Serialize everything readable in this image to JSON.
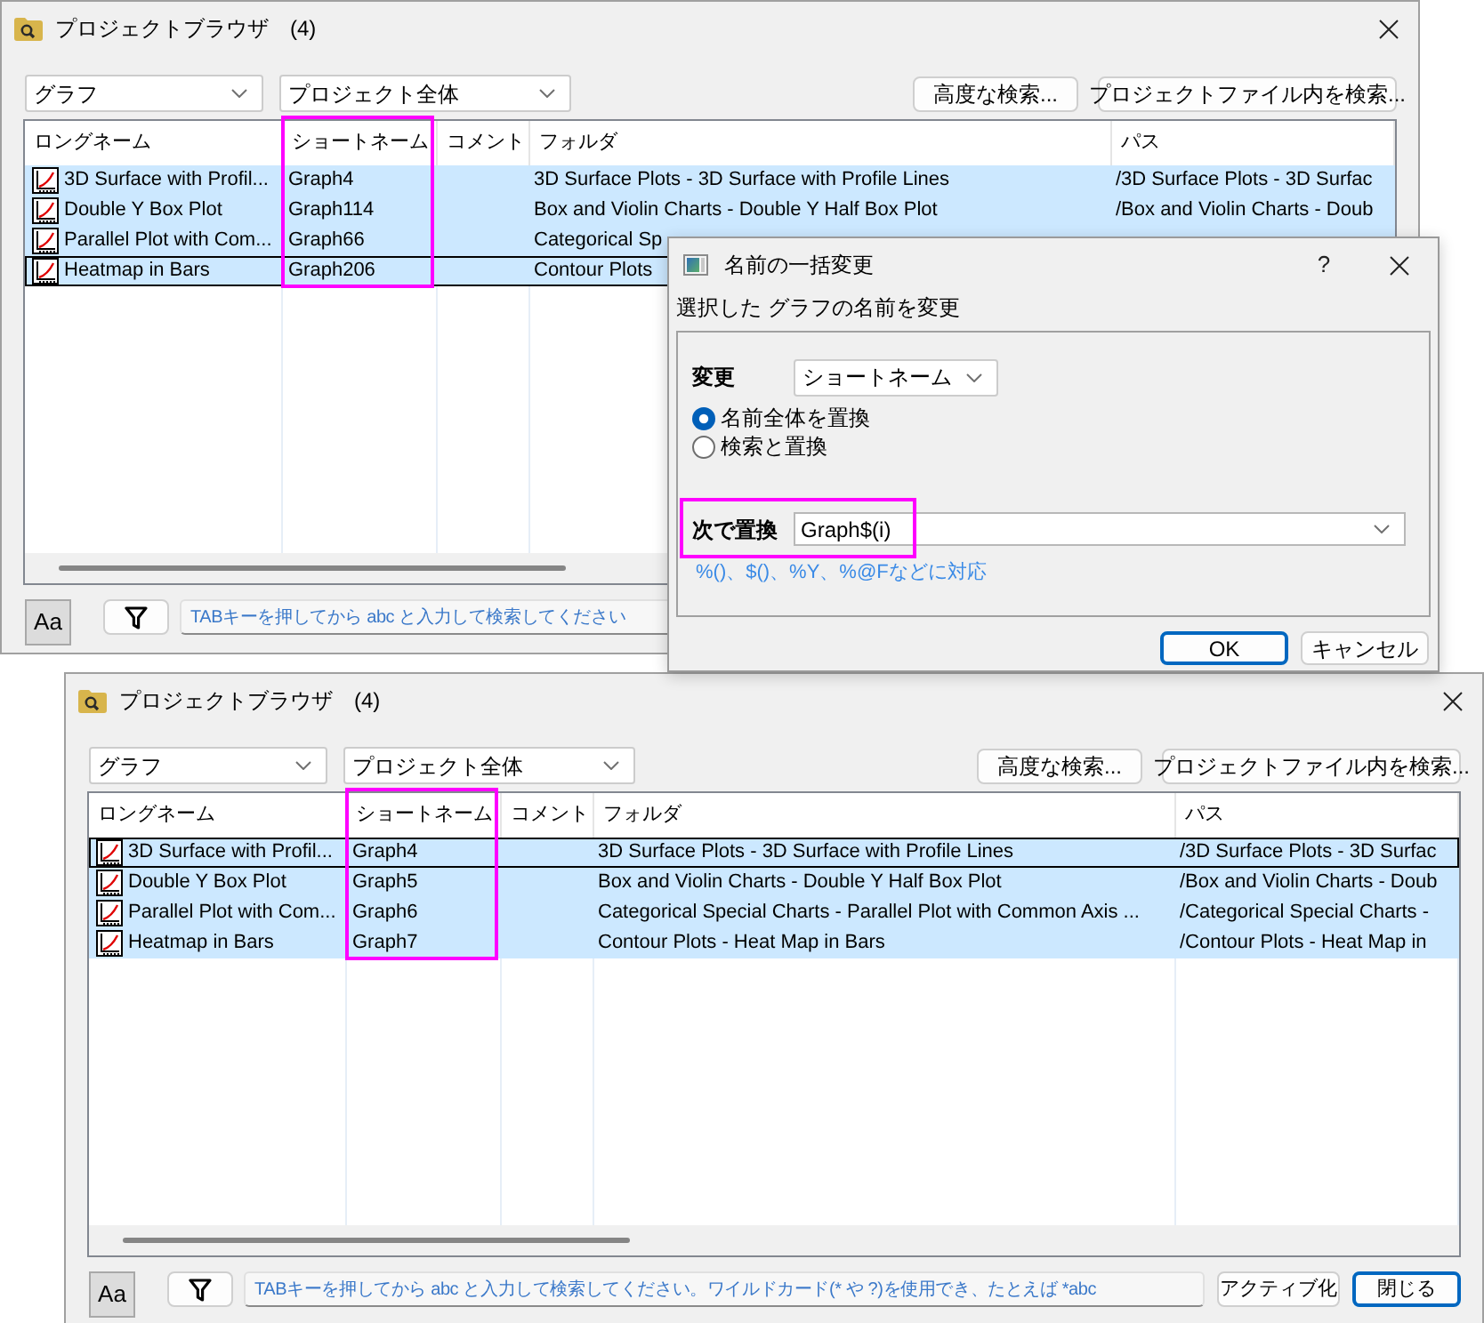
{
  "browser_windows": [
    {
      "title": "プロジェクトブラウザ",
      "count": "(4)",
      "type_filter": "グラフ",
      "scope_filter": "プロジェクト全体",
      "buttons": [
        "高度な検索...",
        "プロジェクトファイル内を検索..."
      ],
      "columns": [
        {
          "label": "ロングネーム"
        },
        {
          "label": "ショートネーム",
          "highlighted": true
        },
        {
          "label": "コメント"
        },
        {
          "label": "フォルダ"
        },
        {
          "label": "パス"
        }
      ],
      "rows": [
        {
          "long_name": "3D Surface with Profil...",
          "short_name": "Graph4",
          "folder": "3D Surface Plots - 3D Surface with Profile Lines",
          "path": "/3D Surface Plots - 3D Surfac",
          "selected": true,
          "focused": false
        },
        {
          "long_name": "Double Y Box Plot",
          "short_name": "Graph114",
          "folder": "Box and Violin Charts - Double Y Half Box Plot",
          "path": "/Box and Violin Charts - Doub",
          "selected": true,
          "focused": false
        },
        {
          "long_name": "Parallel Plot with Com...",
          "short_name": "Graph66",
          "folder": "Categorical Sp",
          "selected": true,
          "focused": false
        },
        {
          "long_name": "Heatmap in Bars",
          "short_name": "Graph206",
          "folder": "Contour Plots",
          "selected": true,
          "focused": true
        }
      ],
      "font_button": "Aa",
      "search": {
        "placeholder": "TABキーを押してから abc と入力して検索してください"
      }
    },
    {
      "title": "プロジェクトブラウザ",
      "count": "(4)",
      "type_filter": "グラフ",
      "scope_filter": "プロジェクト全体",
      "buttons": [
        "高度な検索...",
        "プロジェクトファイル内を検索..."
      ],
      "columns": [
        {
          "label": "ロングネーム"
        },
        {
          "label": "ショートネーム",
          "highlighted": true
        },
        {
          "label": "コメント"
        },
        {
          "label": "フォルダ"
        },
        {
          "label": "パス"
        }
      ],
      "rows": [
        {
          "long_name": "3D Surface with Profil...",
          "short_name": "Graph4",
          "folder": "3D Surface Plots - 3D Surface with Profile Lines",
          "path": "/3D Surface Plots - 3D Surfac",
          "selected": true,
          "focused": true
        },
        {
          "long_name": "Double Y Box Plot",
          "short_name": "Graph5",
          "folder": "Box and Violin Charts - Double Y Half Box Plot",
          "path": "/Box and Violin Charts - Doub",
          "selected": true,
          "focused": false
        },
        {
          "long_name": "Parallel Plot with Com...",
          "short_name": "Graph6",
          "folder": "Categorical Special Charts - Parallel Plot with Common Axis ...",
          "path": "/Categorical Special Charts -",
          "selected": true,
          "focused": false
        },
        {
          "long_name": "Heatmap in Bars",
          "short_name": "Graph7",
          "folder": "Contour Plots - Heat Map in Bars",
          "path": "/Contour Plots - Heat Map in",
          "selected": true,
          "focused": false
        }
      ],
      "font_button": "Aa",
      "search": {
        "placeholder": "TABキーを押してから abc と入力して検索してください。ワイルドカード(* や ?)を使用でき、たとえば *abc"
      },
      "footer_buttons": [
        {
          "label": "アクティブ化",
          "default": false
        },
        {
          "label": "閉じる",
          "default": true
        }
      ]
    }
  ],
  "dialog": {
    "title": "名前の一括変更",
    "help_button": "?",
    "description": "選択した グラフの名前を変更",
    "change_label": "変更",
    "change_target": "ショートネーム",
    "options": [
      {
        "label": "名前全体を置換",
        "selected": true
      },
      {
        "label": "検索と置換",
        "selected": false
      }
    ],
    "replace_label": "次で置換",
    "replace_value": "Graph$(i)",
    "replace_highlighted": true,
    "hint": "%()、$()、%Y、%@Fなどに対応",
    "buttons": [
      {
        "label": "OK",
        "default": true
      },
      {
        "label": "キャンセル",
        "default": false
      }
    ]
  }
}
